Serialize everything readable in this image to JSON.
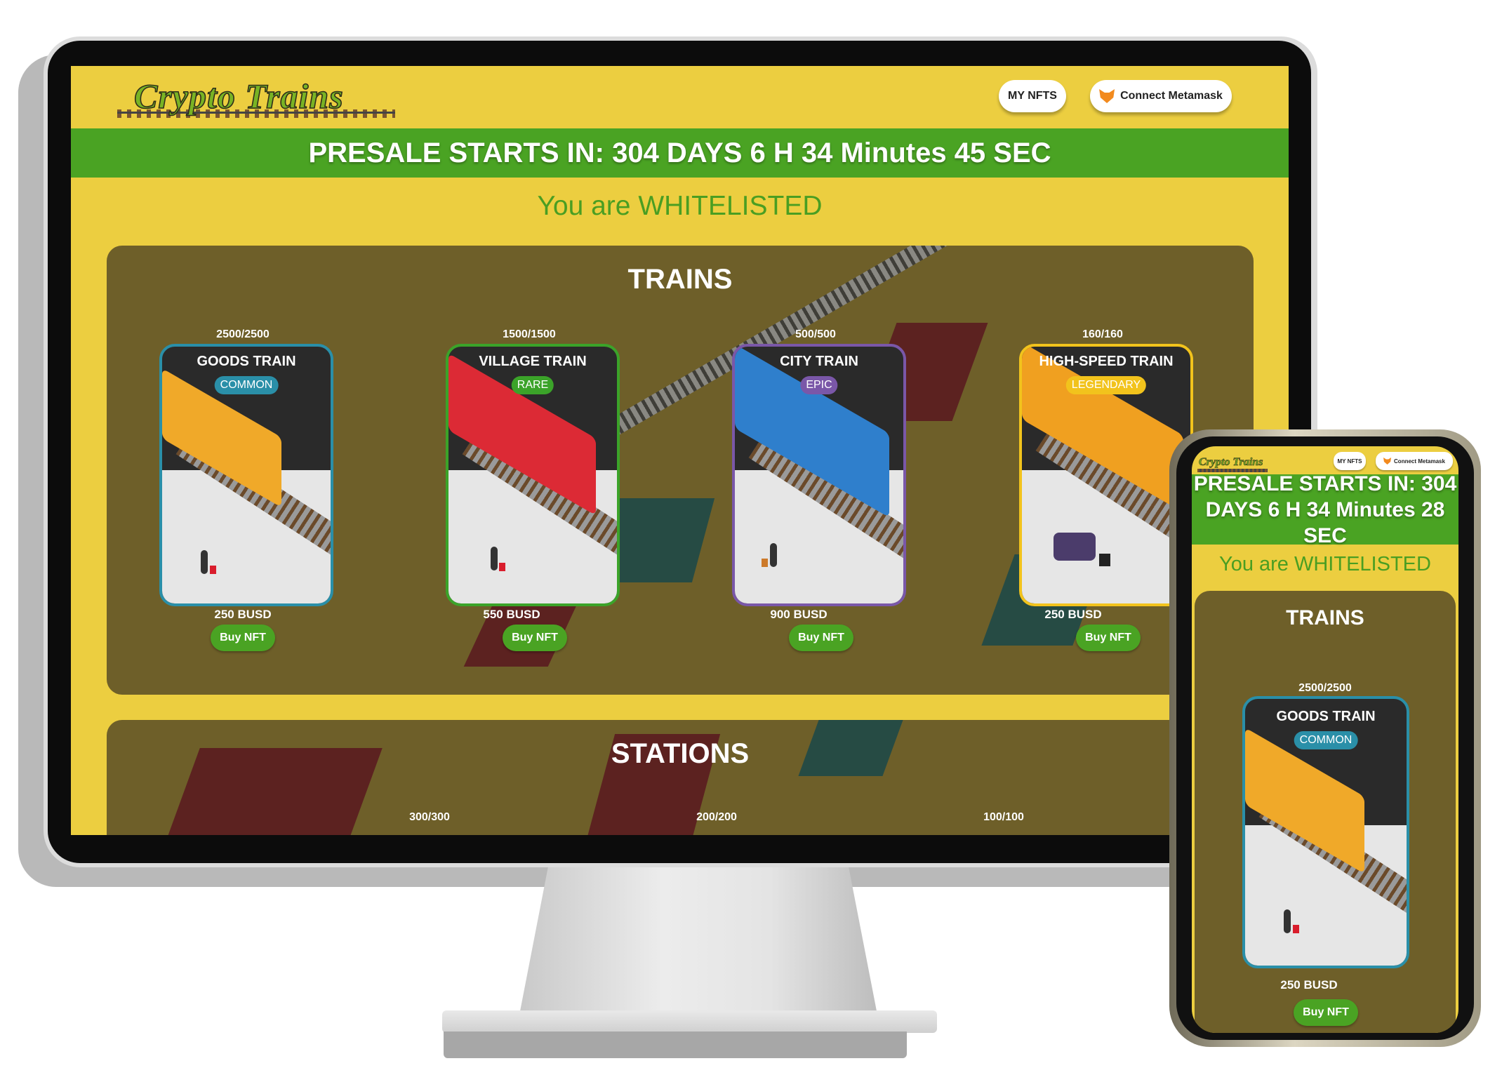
{
  "brand": {
    "logo_text": "Crypto Trains"
  },
  "nav": {
    "my_nfts": "MY NFTS",
    "connect": "Connect Metamask"
  },
  "desktop": {
    "presale": "PRESALE STARTS IN: 304 DAYS 6 H 34 Minutes 45 SEC",
    "whitelist": "You are WHITELISTED"
  },
  "trains": {
    "title": "TRAINS",
    "items": [
      {
        "count": "2500/2500",
        "name": "GOODS TRAIN",
        "rarity": "COMMON",
        "price": "250 BUSD",
        "buy": "Buy NFT",
        "color": "#2a8fa8"
      },
      {
        "count": "1500/1500",
        "name": "VILLAGE TRAIN",
        "rarity": "RARE",
        "price": "550 BUSD",
        "buy": "Buy NFT",
        "color": "#3ba329"
      },
      {
        "count": "500/500",
        "name": "CITY TRAIN",
        "rarity": "EPIC",
        "price": "900 BUSD",
        "buy": "Buy NFT",
        "color": "#7a57a8"
      },
      {
        "count": "160/160",
        "name": "HIGH-SPEED TRAIN",
        "rarity": "LEGENDARY",
        "price": "250 BUSD",
        "buy": "Buy NFT",
        "color": "#f2c31c"
      }
    ]
  },
  "stations": {
    "title": "STATIONS",
    "counts": [
      "300/300",
      "200/200",
      "100/100"
    ]
  },
  "mobile": {
    "presale": "PRESALE STARTS IN: 304 DAYS 6 H 34 Minutes 28 SEC",
    "whitelist": "You are WHITELISTED",
    "trains_title": "TRAINS",
    "card": {
      "count": "2500/2500",
      "name": "GOODS TRAIN",
      "rarity": "COMMON",
      "price": "250 BUSD",
      "buy": "Buy NFT"
    }
  },
  "icons": {
    "wallet": "metamask-fox-icon"
  }
}
